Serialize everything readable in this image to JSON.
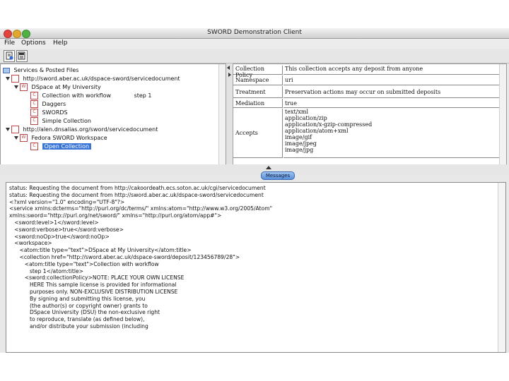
{
  "window": {
    "title": "SWORD Demonstration Client"
  },
  "menu": [
    "File",
    "Options",
    "Help"
  ],
  "toolbar": {
    "icons": [
      "document-add-icon",
      "document-list-icon"
    ]
  },
  "tree": {
    "root": "Services & Posted Files",
    "service1": "http://sword.aber.ac.uk/dspace-sword/servicedocument",
    "workspace1": "DSpace at My University",
    "collections1": [
      {
        "label": "Collection with workflow",
        "note": "step 1"
      },
      {
        "label": "Daggers"
      },
      {
        "label": "SWORDS"
      },
      {
        "label": "Simple Collection"
      }
    ],
    "service2": "http://alen.dnsalias.org/sword/servicedocument",
    "workspace2": "Fedora SWORD Workspace",
    "collection2": "Open Collection"
  },
  "properties": [
    {
      "key": "Collection Policy",
      "value": "This collection accepts any deposit from anyone"
    },
    {
      "key": "Namespace",
      "value": "uri"
    },
    {
      "key": "Treatment",
      "value": "Preservation actions may occur on submitted deposits"
    },
    {
      "key": "Mediation",
      "value": "true"
    },
    {
      "key": "Accepts",
      "value": "text/xml\napplication/zip\napplication/x-gzip-compressed\napplication/atom+xml\nimage/gif\nimage/jpeg\nimage/jpg"
    }
  ],
  "messages_label": "Messages",
  "messages": [
    "status: Requesting the document from http://cakoordeath.ecs.soton.ac.uk/cgi/servicedocument",
    "status: Requesting the document from http://sword.aber.ac.uk/dspace-sword/servicedocument",
    "<?xml version=\"1.0\" encoding=\"UTF-8\"?>",
    "<service xmlns:dcterms=\"http://purl.org/dc/terms/\" xmlns:atom=\"http://www.w3.org/2005/Atom\"",
    "xmlns:sword=\"http://purl.org/net/sword/\" xmlns=\"http://purl.org/atom/app#\">",
    "   <sword:level>1</sword:level>",
    "   <sword:verbose>true</sword:verbose>",
    "   <sword:noOp>true</sword:noOp>",
    "   <workspace>",
    "      <atom:title type=\"text\">DSpace at My University</atom:title>",
    "      <collection href=\"http://sword.aber.ac.uk/dspace-sword/deposit/123456789/28\">",
    "         <atom:title type=\"text\">Collection with workflow",
    "            step 1</atom:title>",
    "         <sword:collectionPolicy>NOTE: PLACE YOUR OWN LICENSE",
    "            HERE This sample license is provided for informational",
    "            purposes only. NON-EXCLUSIVE DISTRIBUTION LICENSE",
    "            By signing and submitting this license, you",
    "            (the author(s) or copyright owner) grants to",
    "            DSpace University (DSU) the non-exclusive right",
    "            to reproduce, translate (as defined below),",
    "            and/or distribute your submission (including"
  ]
}
